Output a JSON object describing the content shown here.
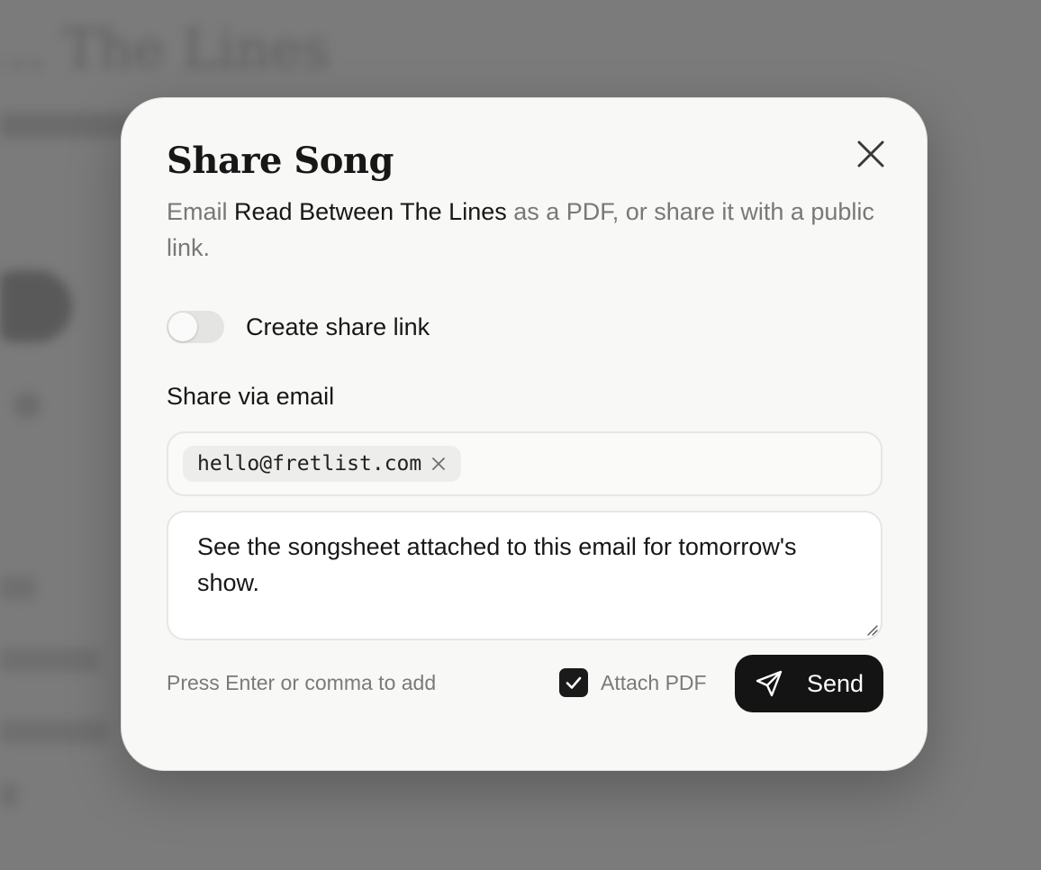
{
  "background": {
    "title": "… The Lines"
  },
  "dialog": {
    "title": "Share Song",
    "description_prefix": "Email ",
    "song_title": "Read Between The Lines",
    "description_suffix": " as a PDF, or share it with a public link.",
    "share_link_toggle": {
      "label": "Create share link",
      "on": false
    },
    "email_section_label": "Share via email",
    "recipients": [
      "hello@fretlist.com"
    ],
    "message": "See the songsheet attached to this email for tomorrow's show.",
    "hint": "Press Enter or comma to add",
    "attach_pdf": {
      "label": "Attach PDF",
      "checked": true
    },
    "send_label": "Send"
  },
  "icons": {
    "close": "close-icon",
    "chip_remove": "x-icon",
    "checkbox": "check-icon",
    "send": "paper-plane-icon",
    "resize": "resize-handle-icon"
  },
  "colors": {
    "backdrop": "#7f7f7f",
    "dialog_bg": "#f8f8f6",
    "primary_button": "#141414",
    "muted_text": "#787878"
  }
}
